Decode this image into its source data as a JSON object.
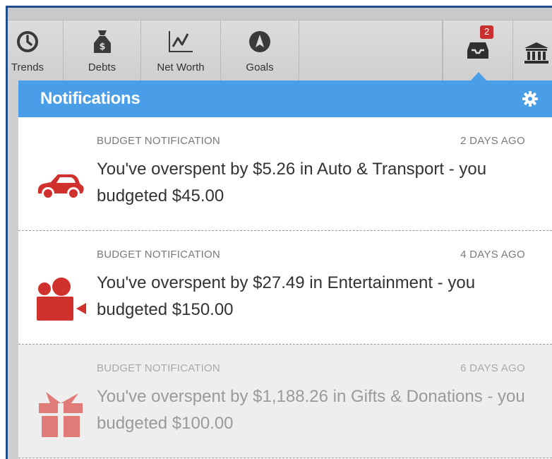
{
  "toolbar": {
    "items": [
      {
        "label": "Trends",
        "icon": "clock-icon"
      },
      {
        "label": "Debts",
        "icon": "money-bag-icon"
      },
      {
        "label": "Net Worth",
        "icon": "line-chart-icon"
      },
      {
        "label": "Goals",
        "icon": "compass-icon"
      }
    ],
    "inbox_badge": "2",
    "inbox_icon": "inbox-tray-icon",
    "bank_icon": "bank-icon"
  },
  "notifications": {
    "title": "Notifications",
    "settings_icon": "gear-icon",
    "items": [
      {
        "category": "BUDGET NOTIFICATION",
        "time": "2 DAYS AGO",
        "message": "You've overspent by $5.26 in Auto & Transport - you budgeted $45.00",
        "icon": "car-icon",
        "read": false
      },
      {
        "category": "BUDGET NOTIFICATION",
        "time": "4 DAYS AGO",
        "message": "You've overspent by $27.49 in Entertainment - you budgeted $150.00",
        "icon": "video-camera-icon",
        "read": false
      },
      {
        "category": "BUDGET NOTIFICATION",
        "time": "6 DAYS AGO",
        "message": "You've overspent by $1,188.26 in Gifts & Donations - you budgeted $100.00",
        "icon": "gift-icon",
        "read": true
      }
    ]
  },
  "colors": {
    "header_blue": "#4a9ee8",
    "frame_blue": "#1e4f8c",
    "icon_red": "#d0312d",
    "icon_red_faded": "#e07b78",
    "badge_red": "#c8302f"
  }
}
